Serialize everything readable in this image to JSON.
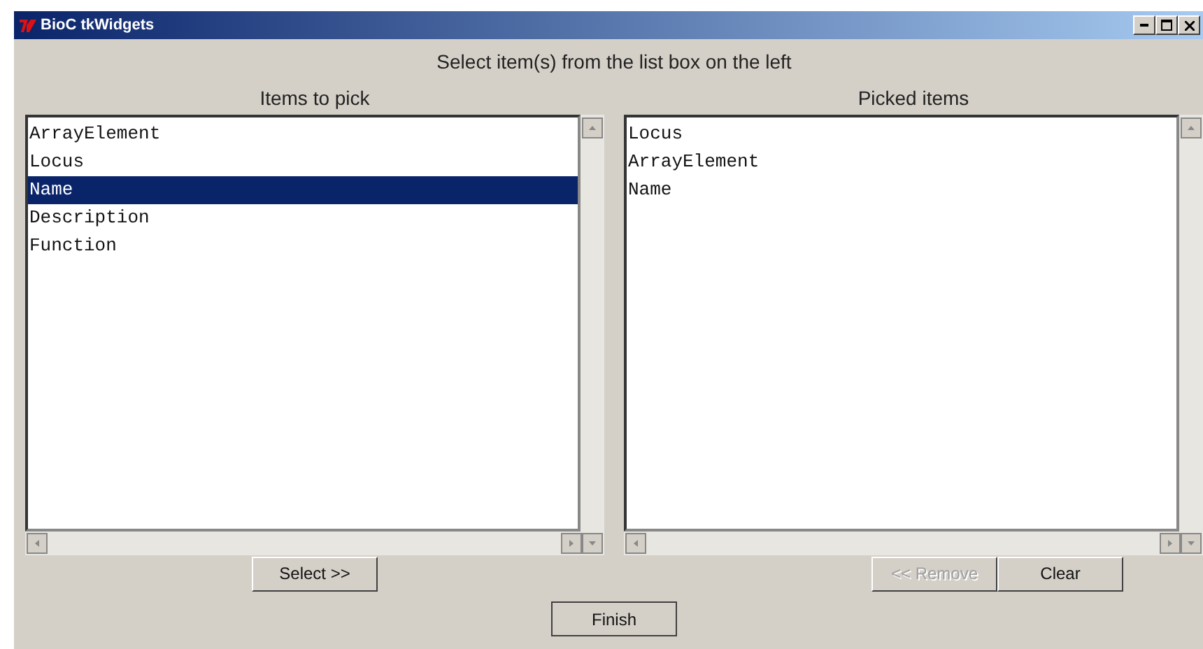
{
  "window": {
    "title": "BioC tkWidgets"
  },
  "instruction": "Select item(s) from the list box on the left",
  "left": {
    "heading": "Items to pick",
    "items": [
      {
        "label": "ArrayElement",
        "selected": false
      },
      {
        "label": "Locus",
        "selected": false
      },
      {
        "label": "Name",
        "selected": true
      },
      {
        "label": "Description",
        "selected": false
      },
      {
        "label": "Function",
        "selected": false
      }
    ]
  },
  "right": {
    "heading": "Picked items",
    "items": [
      {
        "label": "Locus",
        "selected": false
      },
      {
        "label": "ArrayElement",
        "selected": false
      },
      {
        "label": "Name",
        "selected": false
      }
    ]
  },
  "buttons": {
    "select": {
      "label": "Select >>",
      "disabled": false
    },
    "remove": {
      "label": "<< Remove",
      "disabled": true
    },
    "clear": {
      "label": "Clear",
      "disabled": false
    },
    "finish": {
      "label": "Finish",
      "disabled": false
    }
  }
}
